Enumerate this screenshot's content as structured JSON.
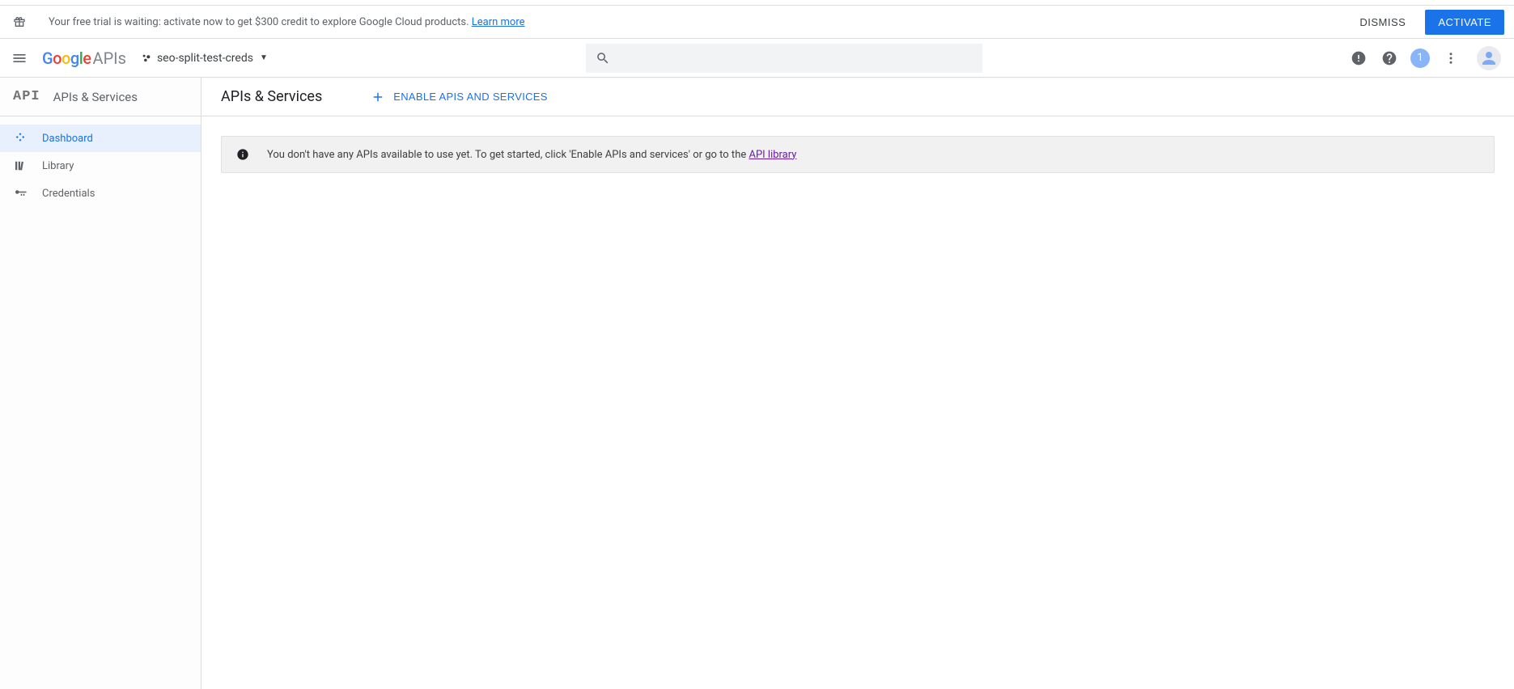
{
  "trial": {
    "text": "Your free trial is waiting: activate now to get $300 credit to explore Google Cloud products.",
    "learn_more": "Learn more",
    "dismiss": "DISMISS",
    "activate": "ACTIVATE"
  },
  "header": {
    "logo_apis": "APIs",
    "project_name": "seo-split-test-creds",
    "notification_count": "1"
  },
  "sidebar": {
    "api_logo": "API",
    "title": "APIs & Services",
    "items": [
      {
        "label": "Dashboard",
        "selected": true
      },
      {
        "label": "Library",
        "selected": false
      },
      {
        "label": "Credentials",
        "selected": false
      }
    ]
  },
  "main": {
    "title": "APIs & Services",
    "enable_label": "ENABLE APIS AND SERVICES",
    "notice_text": "You don't have any APIs available to use yet. To get started, click 'Enable APIs and services' or go to the ",
    "notice_link": "API library"
  }
}
